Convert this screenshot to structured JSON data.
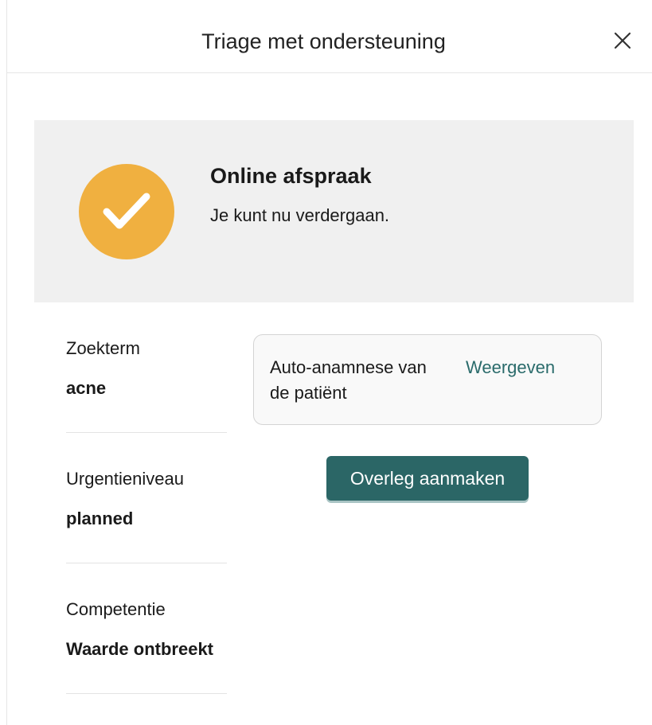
{
  "header": {
    "title": "Triage met ondersteuning",
    "close_icon": "close-icon"
  },
  "banner": {
    "icon": "checkmark-icon",
    "icon_color": "#f0b040",
    "title": "Online afspraak",
    "text": "Je kunt nu verdergaan."
  },
  "fields": [
    {
      "label": "Zoekterm",
      "value": "acne"
    },
    {
      "label": "Urgentieniveau",
      "value": "planned"
    },
    {
      "label": "Competentie",
      "value": "Waarde ontbreekt"
    }
  ],
  "anamnese": {
    "label": "Auto-anamnese van de patiënt",
    "link": "Weergeven"
  },
  "actions": {
    "overleg_label": "Overleg aanmaken",
    "accent_color": "#2b6666"
  }
}
